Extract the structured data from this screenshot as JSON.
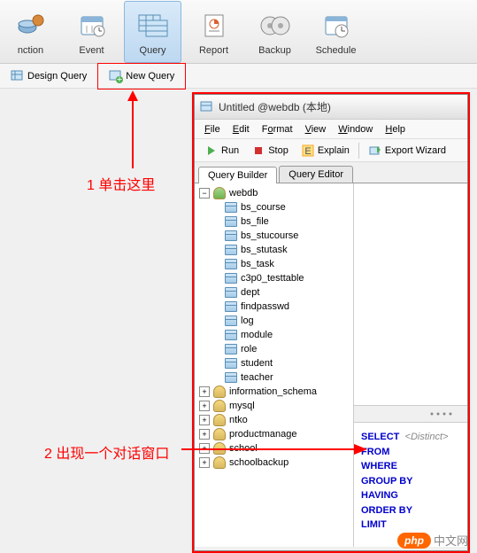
{
  "toolbar": {
    "items": [
      {
        "id": "nction",
        "label": "nction",
        "icon": "gear-icon"
      },
      {
        "id": "event",
        "label": "Event",
        "icon": "calendar-icon"
      },
      {
        "id": "query",
        "label": "Query",
        "icon": "table-icon",
        "active": true
      },
      {
        "id": "report",
        "label": "Report",
        "icon": "report-icon"
      },
      {
        "id": "backup",
        "label": "Backup",
        "icon": "disc-icon"
      },
      {
        "id": "schedule",
        "label": "Schedule",
        "icon": "clock-icon"
      }
    ]
  },
  "subtoolbar": {
    "design": "Design Query",
    "new": "New Query"
  },
  "dialog": {
    "title": "Untitled @webdb (本地)",
    "menu": {
      "file": "File",
      "edit": "Edit",
      "format": "Format",
      "view": "View",
      "window": "Window",
      "help": "Help"
    },
    "actions": {
      "run": "Run",
      "stop": "Stop",
      "explain": "Explain",
      "export": "Export Wizard"
    },
    "tabs": {
      "builder": "Query Builder",
      "editor": "Query Editor"
    }
  },
  "tree": {
    "root": {
      "label": "webdb",
      "expanded": true,
      "type": "db"
    },
    "children": [
      {
        "label": "bs_course",
        "type": "table"
      },
      {
        "label": "bs_file",
        "type": "table"
      },
      {
        "label": "bs_stucourse",
        "type": "table"
      },
      {
        "label": "bs_stutask",
        "type": "table"
      },
      {
        "label": "bs_task",
        "type": "table"
      },
      {
        "label": "c3p0_testtable",
        "type": "table"
      },
      {
        "label": "dept",
        "type": "table"
      },
      {
        "label": "findpasswd",
        "type": "table"
      },
      {
        "label": "log",
        "type": "table"
      },
      {
        "label": "module",
        "type": "table"
      },
      {
        "label": "role",
        "type": "table"
      },
      {
        "label": "student",
        "type": "table"
      },
      {
        "label": "teacher",
        "type": "table"
      }
    ],
    "siblings": [
      {
        "label": "information_schema",
        "type": "db"
      },
      {
        "label": "mysql",
        "type": "db"
      },
      {
        "label": "ntko",
        "type": "db"
      },
      {
        "label": "productmanage",
        "type": "db"
      },
      {
        "label": "school",
        "type": "db"
      },
      {
        "label": "schoolbackup",
        "type": "db"
      }
    ]
  },
  "sql": {
    "select": "SELECT",
    "distinct": "<Distinct>",
    "from": "FROM",
    "where": "WHERE",
    "groupby": "GROUP BY",
    "having": "HAVING",
    "orderby": "ORDER BY",
    "limit": "LIMIT"
  },
  "annotation": {
    "step1": "1  单击这里",
    "step2": "2  出现一个对话窗口"
  },
  "watermark": {
    "badge": "php",
    "text": "中文网"
  }
}
